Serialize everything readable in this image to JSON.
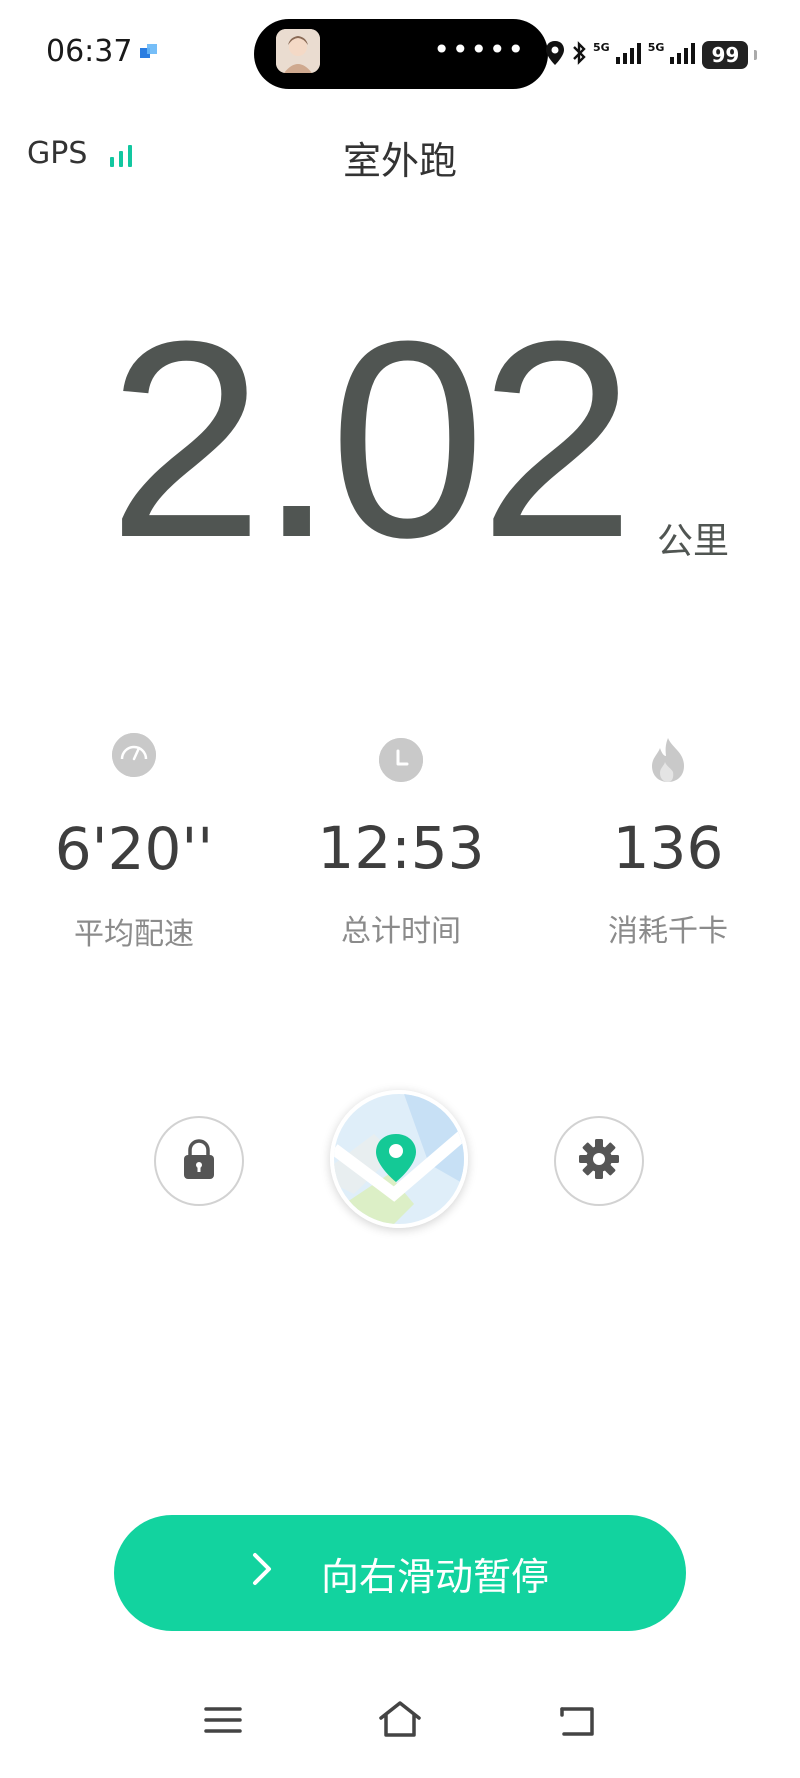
{
  "status_bar": {
    "time": "06:37",
    "signal1": "5G",
    "signal2": "5G",
    "battery": "99"
  },
  "header": {
    "gps_label": "GPS",
    "title": "室外跑"
  },
  "distance": {
    "value": "2.02",
    "unit": "公里"
  },
  "stats": [
    {
      "icon": "speedometer-icon",
      "value": "6'20''",
      "label": "平均配速"
    },
    {
      "icon": "clock-icon",
      "value": "12:53",
      "label": "总计时间"
    },
    {
      "icon": "flame-icon",
      "value": "136",
      "label": "消耗千卡"
    }
  ],
  "controls": {
    "lock": "lock-icon",
    "map": "map-pin-icon",
    "settings": "gear-icon"
  },
  "slide_button": {
    "label": "向右滑动暂停"
  },
  "colors": {
    "accent": "#12d39f",
    "gps_signal": "#12c7a0",
    "digits": "#505552"
  }
}
